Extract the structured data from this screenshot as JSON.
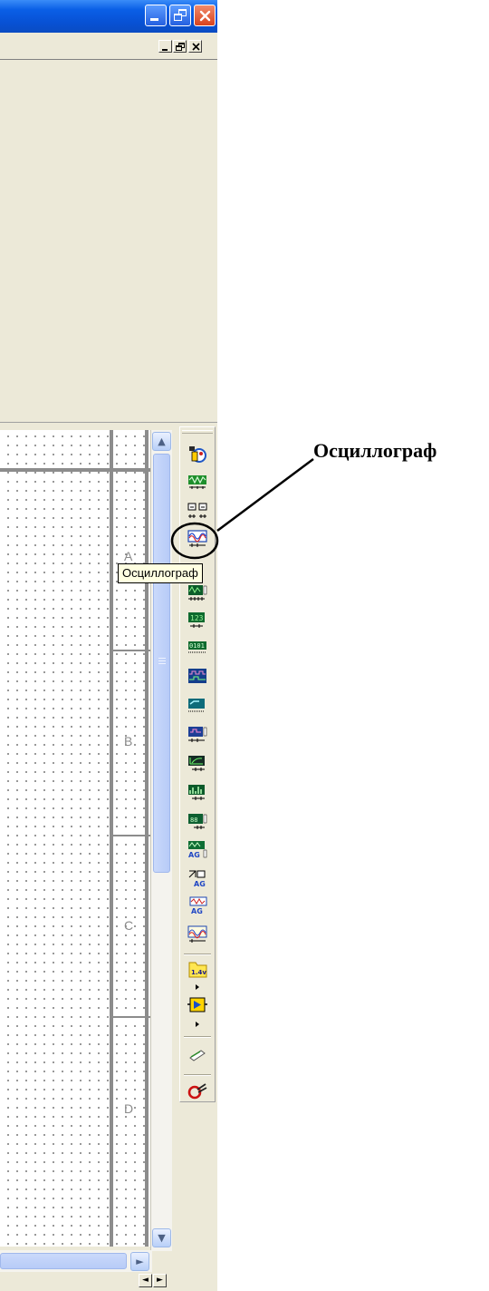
{
  "titlebar": {
    "minimize_glyph": "_",
    "restore_glyph": "❐",
    "close_glyph": "✕"
  },
  "mdi": {
    "minimize_glyph": "_",
    "restore_glyph": "ð",
    "close_glyph": "×"
  },
  "schematic": {
    "zones": [
      "A",
      "B",
      "C",
      "D"
    ]
  },
  "scrollbar": {
    "up_glyph": "▲",
    "down_glyph": "▼",
    "right_glyph": "►"
  },
  "tabs_nav": {
    "left_glyph": "◄",
    "right_glyph": "►"
  },
  "toolbar": {
    "tooltip": "Осциллограф",
    "instruments": [
      "multimeter-icon",
      "function-generator-icon",
      "wattmeter-icon",
      "oscilloscope-icon",
      "four-channel-oscilloscope-icon",
      "bode-plotter-icon",
      "frequency-counter-icon",
      "word-generator-icon",
      "logic-analyzer-icon",
      "logic-converter-icon",
      "iv-analyzer-icon",
      "distortion-analyzer-icon",
      "spectrum-analyzer-icon",
      "network-analyzer-icon",
      "agilent-function-generator-icon",
      "agilent-multimeter-icon",
      "agilent-oscilloscope-icon",
      "tektronix-oscilloscope-icon",
      "measurement-probe-icon",
      "labview-instrument-icon",
      "current-probe-icon",
      "current-clamp-icon"
    ],
    "probe_value": "1.4v"
  },
  "annotation": {
    "label": "Осциллограф"
  },
  "colors": {
    "title_bar": "#0a5fe6",
    "window_bg": "#ece9d8",
    "scroll_thumb": "#c1d3fb",
    "tooltip_bg": "#ffffe1",
    "grid_dot": "#555555",
    "zone_border": "#8c8c8c"
  }
}
